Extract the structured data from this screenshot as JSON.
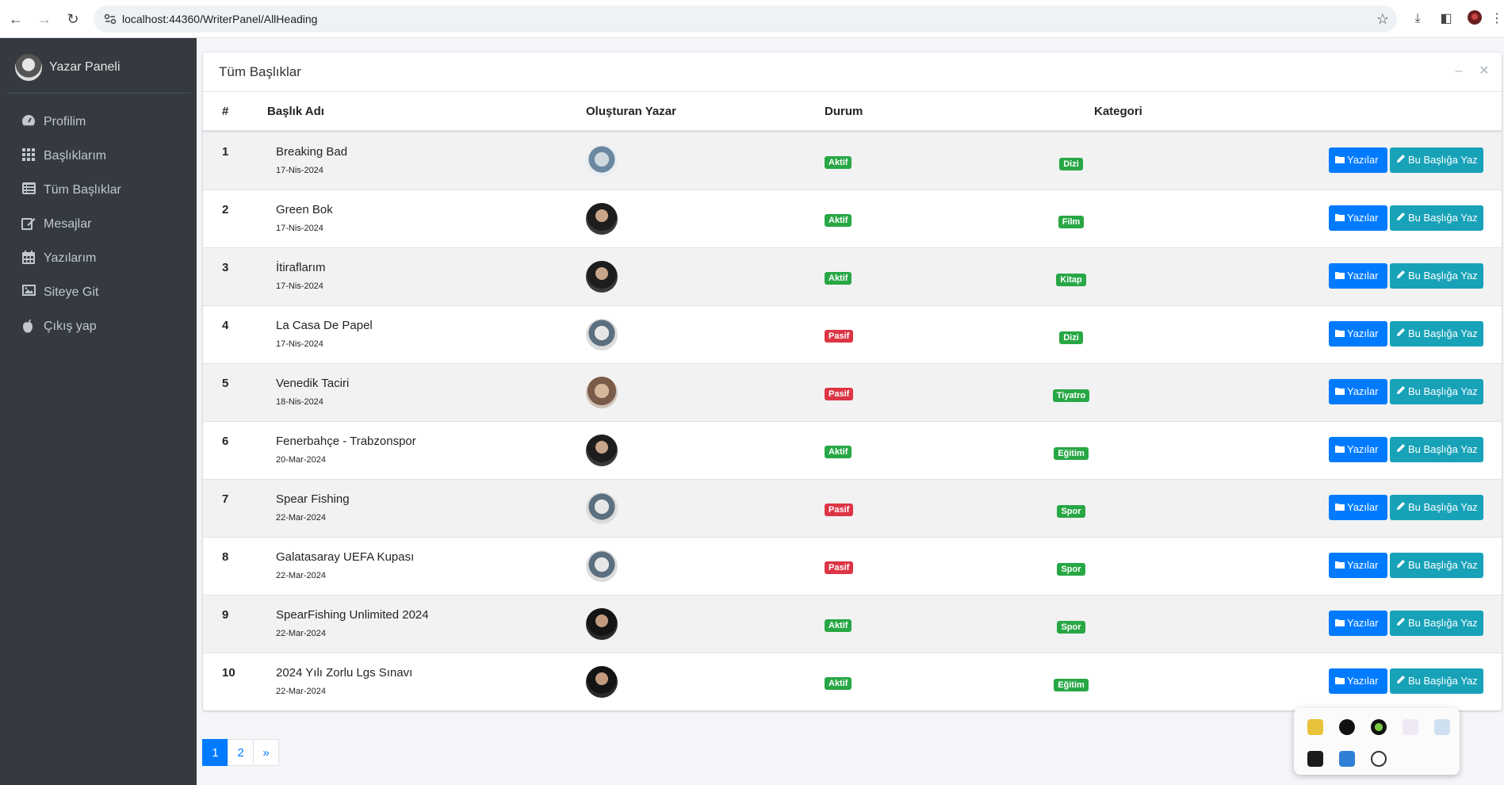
{
  "browser": {
    "url": "localhost:44360/WriterPanel/AllHeading"
  },
  "sidebar": {
    "brand": "Yazar Paneli",
    "items": [
      {
        "label": "Profilim",
        "icon": "dashboard-icon"
      },
      {
        "label": "Başlıklarım",
        "icon": "grid-icon"
      },
      {
        "label": "Tüm Başlıklar",
        "icon": "list-icon"
      },
      {
        "label": "Mesajlar",
        "icon": "edit-icon"
      },
      {
        "label": "Yazılarım",
        "icon": "calendar-icon"
      },
      {
        "label": "Siteye Git",
        "icon": "image-icon"
      },
      {
        "label": "Çıkış yap",
        "icon": "apple-icon"
      }
    ]
  },
  "card": {
    "title": "Tüm Başlıklar",
    "columns": {
      "num": "#",
      "title": "Başlık Adı",
      "author": "Oluşturan Yazar",
      "status": "Durum",
      "category": "Kategori"
    },
    "buttons": {
      "posts": "Yazılar",
      "write": "Bu Başlığa Yaz"
    },
    "rows": [
      {
        "num": "1",
        "title": "Breaking Bad",
        "date": "17-Nis-2024",
        "status": "Aktif",
        "status_color": "#28a745",
        "category": "Dizi"
      },
      {
        "num": "2",
        "title": "Green Bok",
        "date": "17-Nis-2024",
        "status": "Aktif",
        "status_color": "#28a745",
        "category": "Film"
      },
      {
        "num": "3",
        "title": "İtiraflarım",
        "date": "17-Nis-2024",
        "status": "Aktif",
        "status_color": "#28a745",
        "category": "Kitap"
      },
      {
        "num": "4",
        "title": "La Casa De Papel",
        "date": "17-Nis-2024",
        "status": "Pasif",
        "status_color": "#dc3545",
        "category": "Dizi"
      },
      {
        "num": "5",
        "title": "Venedik Taciri",
        "date": "18-Nis-2024",
        "status": "Pasif",
        "status_color": "#dc3545",
        "category": "Tiyatro"
      },
      {
        "num": "6",
        "title": "Fenerbahçe - Trabzonspor",
        "date": "20-Mar-2024",
        "status": "Aktif",
        "status_color": "#28a745",
        "category": "Eğitim"
      },
      {
        "num": "7",
        "title": "Spear Fishing",
        "date": "22-Mar-2024",
        "status": "Pasif",
        "status_color": "#dc3545",
        "category": "Spor"
      },
      {
        "num": "8",
        "title": "Galatasaray UEFA Kupası",
        "date": "22-Mar-2024",
        "status": "Pasif",
        "status_color": "#dc3545",
        "category": "Spor"
      },
      {
        "num": "9",
        "title": "SpearFishing Unlimited 2024",
        "date": "22-Mar-2024",
        "status": "Aktif",
        "status_color": "#28a745",
        "category": "Spor"
      },
      {
        "num": "10",
        "title": "2024 Yılı Zorlu Lgs Sınavı",
        "date": "22-Mar-2024",
        "status": "Aktif",
        "status_color": "#28a745",
        "category": "Eğitim"
      }
    ]
  },
  "pagination": {
    "pages": [
      "1",
      "2",
      "»"
    ],
    "active": "1"
  },
  "colors": {
    "primary": "#007bff",
    "info": "#17a2b8",
    "success": "#28a745",
    "danger": "#dc3545",
    "sidebar": "#343a40"
  }
}
